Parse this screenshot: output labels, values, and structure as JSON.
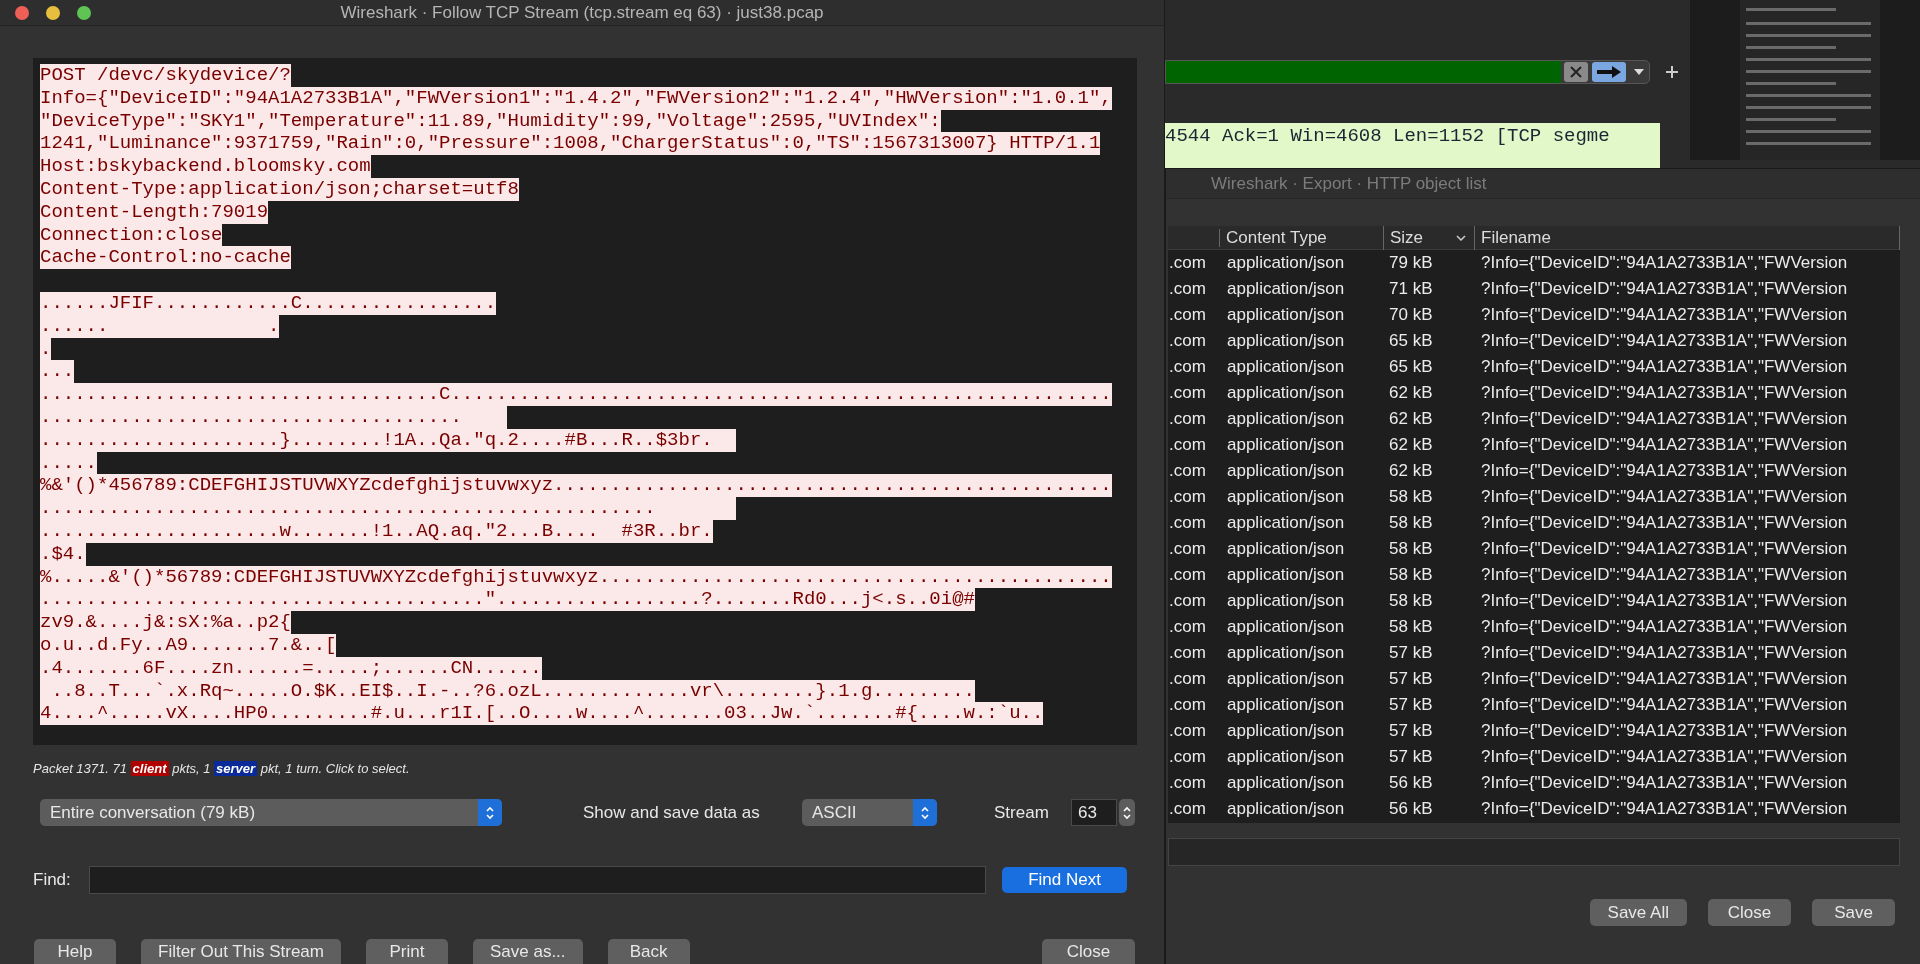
{
  "stream_window": {
    "title": "Wireshark · Follow TCP Stream (tcp.stream eq 63) · just38.pcap",
    "request_lines": [
      "POST /devc/skydevice/?",
      "Info={\"DeviceID\":\"94A1A2733B1A\",\"FWVersion1\":\"1.4.2\",\"FWVersion2\":\"1.2.4\",\"HWVersion\":\"1.0.1\",",
      "\"DeviceType\":\"SKY1\",\"Temperature\":11.89,\"Humidity\":99,\"Voltage\":2595,\"UVIndex\":",
      "1241,\"Luminance\":9371759,\"Rain\":0,\"Pressure\":1008,\"ChargerStatus\":0,\"TS\":1567313007} HTTP/1.1",
      "Host:bskybackend.bloomsky.com",
      "Content-Type:application/json;charset=utf8",
      "Content-Length:79019",
      "Connection:close",
      "Cache-Control:no-cache"
    ],
    "payload_lines": [
      "......JFIF............C.................",
      "......              .",
      ".",
      "...",
      "...................................C..........................................................",
      ".....................................    ",
      ".....................}........!1A..Qa.\"q.2....#B...R..$3br.  ",
      ".....",
      "%&'()*456789:CDEFGHIJSTUVWXYZcdefghijstuvwxyz.................................................",
      "......................................................       ",
      ".....................w.......!1..AQ.aq.\"2...B....  #3R..br.",
      ".$4.",
      "%.....&'()*56789:CDEFGHIJSTUVWXYZcdefghijstuvwxyz.............................................",
      ".......................................\"..................?.......Rd0...j<.s..0i@#",
      "zv9.&....j&:sX:%a..p2{",
      "o.u..d.Fy..A9.......7.&..[",
      ".4.......6F....zn......=.....;......CN......",
      " ..8..T...`.x.Rq~.....O.$K..EI$..I.-..?6.ozL.............vr\\........}.1.g.........",
      "4....^.....vX....HP0.........#.u...r1I.[..O....w....^.......03..Jw.`.......#{....w.:`u.."
    ],
    "packet_summary": {
      "prefix": "Packet 1371. 71 ",
      "client": "client",
      "middle": " pkts, 1 ",
      "server": "server",
      "suffix": " pkt, 1 turn. Click to select."
    },
    "conversation_select": "Entire conversation (79 kB)",
    "format_label": "Show and save data as",
    "format_select": "ASCII",
    "stream_label": "Stream",
    "stream_value": "63",
    "find_label": "Find:",
    "find_button": "Find Next",
    "buttons": [
      "Help",
      "Filter Out This Stream",
      "Print",
      "Save as...",
      "Back"
    ],
    "close_button": "Close"
  },
  "background_window": {
    "packet_row": "4544 Ack=1 Win=4608 Len=1152 [TCP segme"
  },
  "export_window": {
    "title": "Wireshark · Export · HTTP object list",
    "columns": [
      {
        "label": "Content Type",
        "sorted": false
      },
      {
        "label": "Size",
        "sorted": true
      },
      {
        "label": "Filename",
        "sorted": false
      }
    ],
    "rows": [
      {
        "column_1": ".com",
        "content_type": "application/json",
        "size": "79 kB",
        "filename": "?Info={\"DeviceID\":\"94A1A2733B1A\",\"FWVersion"
      },
      {
        "column_1": ".com",
        "content_type": "application/json",
        "size": "71 kB",
        "filename": "?Info={\"DeviceID\":\"94A1A2733B1A\",\"FWVersion"
      },
      {
        "column_1": ".com",
        "content_type": "application/json",
        "size": "70 kB",
        "filename": "?Info={\"DeviceID\":\"94A1A2733B1A\",\"FWVersion"
      },
      {
        "column_1": ".com",
        "content_type": "application/json",
        "size": "65 kB",
        "filename": "?Info={\"DeviceID\":\"94A1A2733B1A\",\"FWVersion"
      },
      {
        "column_1": ".com",
        "content_type": "application/json",
        "size": "65 kB",
        "filename": "?Info={\"DeviceID\":\"94A1A2733B1A\",\"FWVersion"
      },
      {
        "column_1": ".com",
        "content_type": "application/json",
        "size": "62 kB",
        "filename": "?Info={\"DeviceID\":\"94A1A2733B1A\",\"FWVersion"
      },
      {
        "column_1": ".com",
        "content_type": "application/json",
        "size": "62 kB",
        "filename": "?Info={\"DeviceID\":\"94A1A2733B1A\",\"FWVersion"
      },
      {
        "column_1": ".com",
        "content_type": "application/json",
        "size": "62 kB",
        "filename": "?Info={\"DeviceID\":\"94A1A2733B1A\",\"FWVersion"
      },
      {
        "column_1": ".com",
        "content_type": "application/json",
        "size": "62 kB",
        "filename": "?Info={\"DeviceID\":\"94A1A2733B1A\",\"FWVersion"
      },
      {
        "column_1": ".com",
        "content_type": "application/json",
        "size": "58 kB",
        "filename": "?Info={\"DeviceID\":\"94A1A2733B1A\",\"FWVersion"
      },
      {
        "column_1": ".com",
        "content_type": "application/json",
        "size": "58 kB",
        "filename": "?Info={\"DeviceID\":\"94A1A2733B1A\",\"FWVersion"
      },
      {
        "column_1": ".com",
        "content_type": "application/json",
        "size": "58 kB",
        "filename": "?Info={\"DeviceID\":\"94A1A2733B1A\",\"FWVersion"
      },
      {
        "column_1": ".com",
        "content_type": "application/json",
        "size": "58 kB",
        "filename": "?Info={\"DeviceID\":\"94A1A2733B1A\",\"FWVersion"
      },
      {
        "column_1": ".com",
        "content_type": "application/json",
        "size": "58 kB",
        "filename": "?Info={\"DeviceID\":\"94A1A2733B1A\",\"FWVersion"
      },
      {
        "column_1": ".com",
        "content_type": "application/json",
        "size": "58 kB",
        "filename": "?Info={\"DeviceID\":\"94A1A2733B1A\",\"FWVersion"
      },
      {
        "column_1": ".com",
        "content_type": "application/json",
        "size": "57 kB",
        "filename": "?Info={\"DeviceID\":\"94A1A2733B1A\",\"FWVersion"
      },
      {
        "column_1": ".com",
        "content_type": "application/json",
        "size": "57 kB",
        "filename": "?Info={\"DeviceID\":\"94A1A2733B1A\",\"FWVersion"
      },
      {
        "column_1": ".com",
        "content_type": "application/json",
        "size": "57 kB",
        "filename": "?Info={\"DeviceID\":\"94A1A2733B1A\",\"FWVersion"
      },
      {
        "column_1": ".com",
        "content_type": "application/json",
        "size": "57 kB",
        "filename": "?Info={\"DeviceID\":\"94A1A2733B1A\",\"FWVersion"
      },
      {
        "column_1": ".com",
        "content_type": "application/json",
        "size": "57 kB",
        "filename": "?Info={\"DeviceID\":\"94A1A2733B1A\",\"FWVersion"
      },
      {
        "column_1": ".com",
        "content_type": "application/json",
        "size": "56 kB",
        "filename": "?Info={\"DeviceID\":\"94A1A2733B1A\",\"FWVersion"
      },
      {
        "column_1": ".com",
        "content_type": "application/json",
        "size": "56 kB",
        "filename": "?Info={\"DeviceID\":\"94A1A2733B1A\",\"FWVersion"
      }
    ],
    "buttons": [
      "Save All",
      "Close",
      "Save"
    ]
  }
}
